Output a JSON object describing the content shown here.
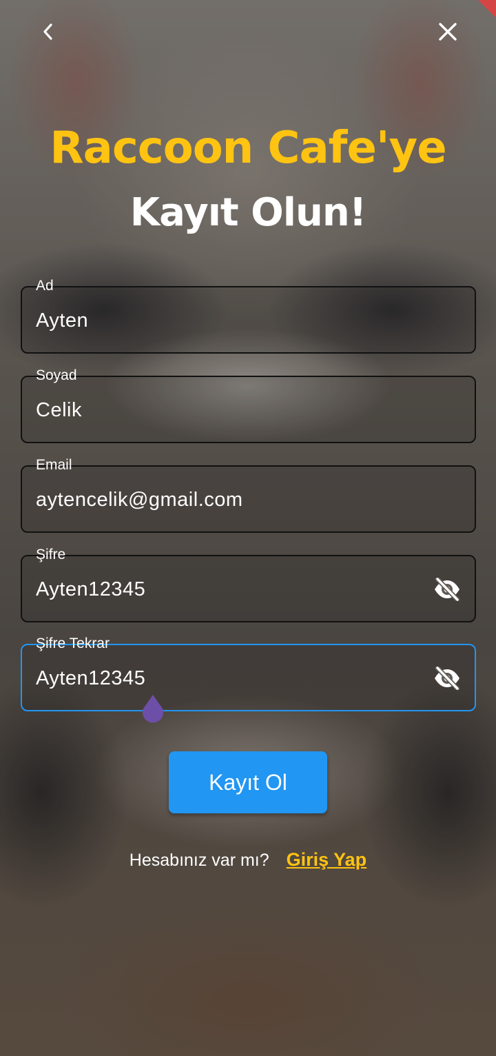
{
  "header": {
    "back_icon": "chevron-left-icon",
    "close_icon": "close-icon"
  },
  "title": {
    "line1": "Raccoon Cafe'ye",
    "line2": "Kayıt Olun!"
  },
  "form": {
    "fields": [
      {
        "label": "Ad",
        "value": "Ayten"
      },
      {
        "label": "Soyad",
        "value": "Celik"
      },
      {
        "label": "Email",
        "value": "aytencelik@gmail.com"
      },
      {
        "label": "Şifre",
        "value": "Ayten12345",
        "icon": "eye-off-icon"
      },
      {
        "label": "Şifre Tekrar",
        "value": "Ayten12345",
        "icon": "eye-off-icon",
        "focused": true
      }
    ],
    "submit_label": "Kayıt Ol"
  },
  "footer": {
    "prompt": "Hesabınız var mı?",
    "link": "Giriş Yap"
  },
  "colors": {
    "accent": "#ffc312",
    "primary": "#2196f3",
    "cursor": "#6e4fa8"
  }
}
